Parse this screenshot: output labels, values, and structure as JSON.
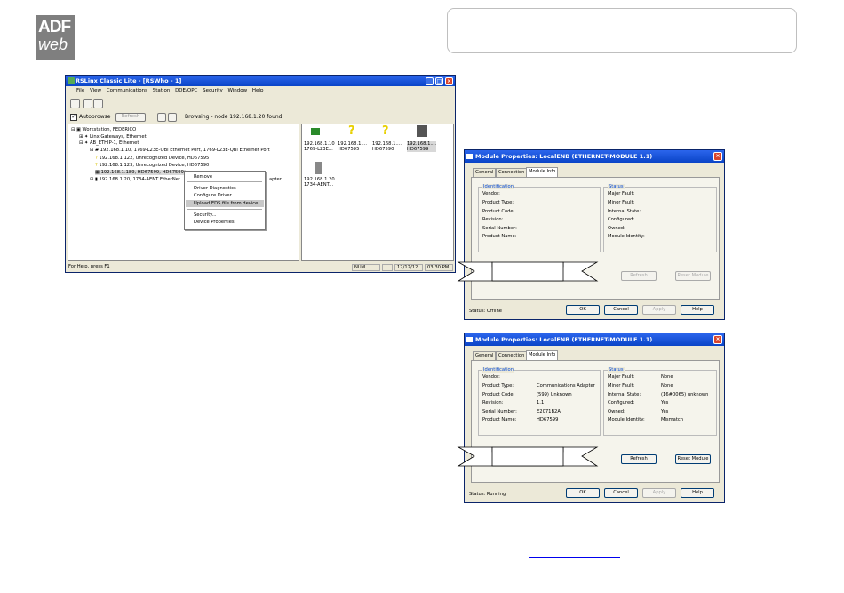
{
  "logo": {
    "line1": "ADF",
    "line2": "web"
  },
  "rslinx": {
    "title": "RSLinx Classic Lite - [RSWho - 1]",
    "menu": [
      "File",
      "View",
      "Communications",
      "Station",
      "DDE/OPC",
      "Security",
      "Window",
      "Help"
    ],
    "autobrowse": "Autobrowse",
    "refresh": "Refresh",
    "browse_status": "Browsing - node 192.168.1.20 found",
    "tree": [
      "Workstation, FEDERICO",
      "Linx Gateways, Ethernet",
      "AB_ETHIP-1, Ethernet",
      "192.168.1.10, 1769-L23E-QBl Ethernet Port, 1769-L23E-QBl Ethernet Port",
      "192.168.1.122, Unrecognized Device, HD67595",
      "192.168.1.123, Unrecognized Device, HD67590",
      "192.168.1.189, HD67599, HD67599",
      "192.168.1.20, 1734-AENT EtherNet",
      "apter"
    ],
    "context_menu": [
      "Remove",
      "Driver Diagnostics",
      "Configure Driver",
      "Upload EDS file from device",
      "Security...",
      "Device Properties"
    ],
    "devices": [
      {
        "l1": "192.168.1.10",
        "l2": "1769-L23E..."
      },
      {
        "l1": "192.168.1....",
        "l2": "HD67595"
      },
      {
        "l1": "192.168.1....",
        "l2": "HD67590"
      },
      {
        "l1": "192.168.1....",
        "l2": "HD67599"
      },
      {
        "l1": "192.168.1.20",
        "l2": "1734-AENT..."
      }
    ],
    "status": {
      "help": "For Help, press F1",
      "num": "NUM",
      "date": "12/12/12",
      "time": "03:30 PM"
    }
  },
  "dialog1": {
    "title": "Module Properties: LocalENB (ETHERNET-MODULE 1.1)",
    "tabs": [
      "General",
      "Connection",
      "Module Info"
    ],
    "ident_title": "Identification",
    "ident_labels": [
      "Vendor:",
      "Product Type:",
      "Product Code:",
      "Revision:",
      "Serial Number:",
      "Product Name:"
    ],
    "status_title": "Status",
    "status_labels": [
      "Major Fault:",
      "Minor Fault:",
      "Internal State:",
      "Configured:",
      "Owned:",
      "Module Identity:"
    ],
    "refresh": "Refresh",
    "reset": "Reset Module",
    "status": "Status:  Offline",
    "ok": "OK",
    "cancel": "Cancel",
    "apply": "Apply",
    "help": "Help"
  },
  "dialog2": {
    "title": "Module Properties: LocalENB (ETHERNET-MODULE 1.1)",
    "tabs": [
      "General",
      "Connection",
      "Module Info"
    ],
    "ident_title": "Identification",
    "ident_labels": [
      "Vendor:",
      "Product Type:",
      "Product Code:",
      "Revision:",
      "Serial Number:",
      "Product Name:"
    ],
    "ident_values": [
      "",
      "Communications Adapter",
      "(599) Unknown",
      "1.1",
      "E2071B2A",
      "HD67599"
    ],
    "status_title": "Status",
    "status_labels": [
      "Major Fault:",
      "Minor Fault:",
      "Internal State:",
      "Configured:",
      "Owned:",
      "Module Identity:"
    ],
    "status_values": [
      "None",
      "None",
      "(16#0065) unknown",
      "Yes",
      "Yes",
      "Mismatch"
    ],
    "refresh": "Refresh",
    "reset": "Reset Module",
    "status": "Status:  Running",
    "ok": "OK",
    "cancel": "Cancel",
    "apply": "Apply",
    "help": "Help"
  }
}
